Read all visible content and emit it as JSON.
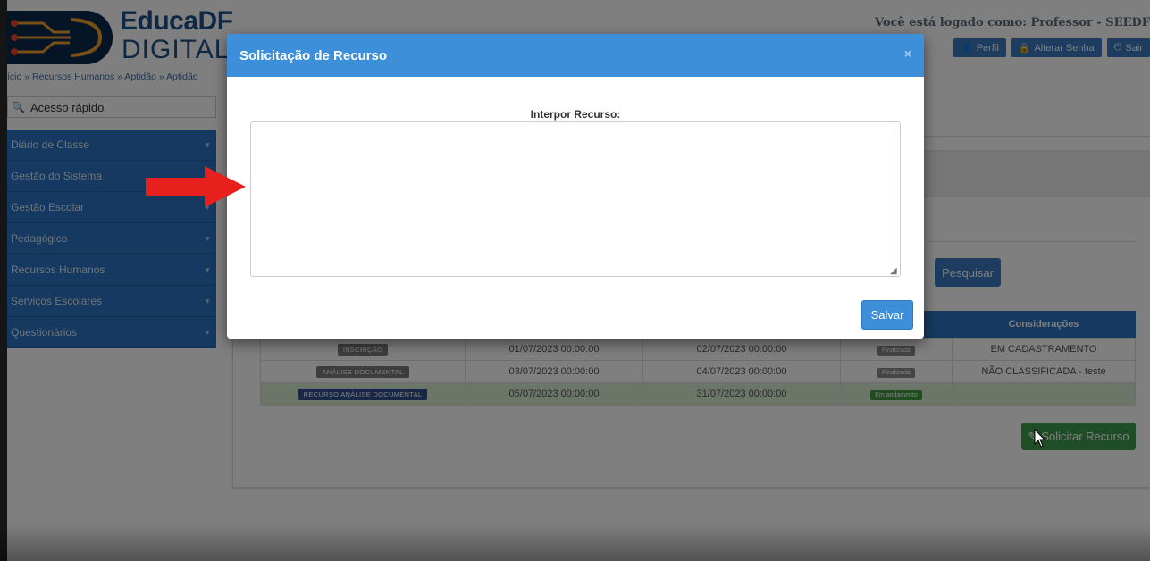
{
  "header": {
    "logo_title": "EducaDF",
    "logo_sub": "DIGITAL",
    "logged_text": "Você está logado como: Professor - SEEDF",
    "buttons": {
      "perfil": "Perfil",
      "senha": "Alterar Senha",
      "sair": "Sair"
    }
  },
  "breadcrumb": "ício » Recursos Humanos » Aptidão » Aptidão",
  "quick_access": {
    "placeholder": "Acesso rápido"
  },
  "sidebar": {
    "items": [
      {
        "label": "Diário de Classe"
      },
      {
        "label": "Gestão do Sistema"
      },
      {
        "label": "Gestão Escolar"
      },
      {
        "label": "Pedagógico"
      },
      {
        "label": "Recursos Humanos"
      },
      {
        "label": "Serviços Escolares"
      },
      {
        "label": "Questionários"
      }
    ]
  },
  "content": {
    "pesquisar_label": "Pesquisar",
    "table": {
      "header_consideracoes": "Considerações",
      "rows": [
        {
          "etapa": "INSCRIÇÃO",
          "inicio": "01/07/2023 00:00:00",
          "fim": "02/07/2023 00:00:00",
          "status": "Finalizada",
          "consideracoes": "EM CADASTRAMENTO"
        },
        {
          "etapa": "ANÁLISE DOCUMENTAL",
          "inicio": "03/07/2023 00:00:00",
          "fim": "04/07/2023 00:00:00",
          "status": "Finalizada",
          "consideracoes": "NÃO CLASSIFICADA - teste"
        },
        {
          "etapa": "RECURSO ANÁLISE DOCUMENTAL",
          "inicio": "05/07/2023 00:00:00",
          "fim": "31/07/2023 00:00:00",
          "status": "Em andamento",
          "consideracoes": ""
        }
      ]
    },
    "solicitar_label": "Solicitar Recurso"
  },
  "modal": {
    "title": "Solicitação de Recurso",
    "close": "×",
    "field_label": "Interpor Recurso:",
    "textarea_value": "",
    "save_label": "Salvar"
  }
}
